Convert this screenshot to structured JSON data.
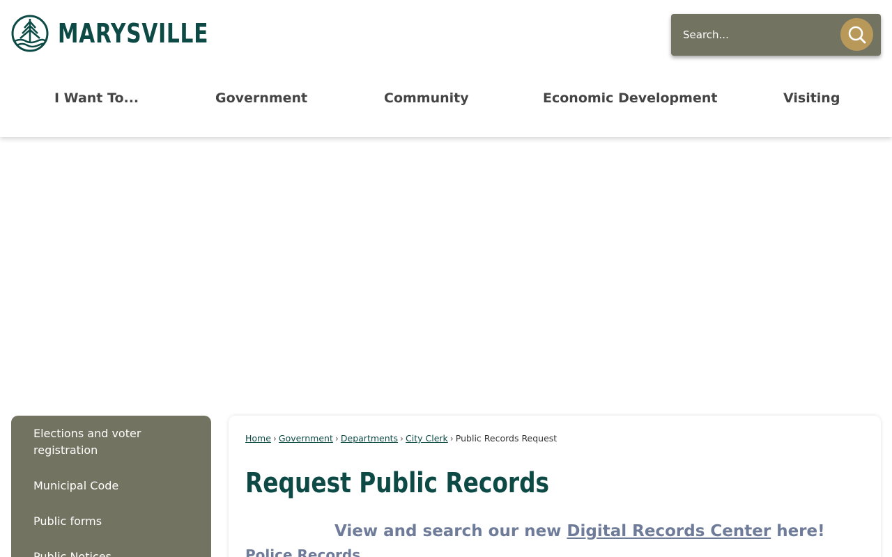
{
  "site": {
    "name": "MARYSVILLE",
    "brand_color": "#0d4a45",
    "accent_color": "#b9995a",
    "panel_color": "#727360",
    "logo_icon": "evergreen-tree-wave-icon"
  },
  "search": {
    "placeholder": "Search...",
    "button_icon": "search-icon"
  },
  "nav": {
    "items": [
      "I Want To...",
      "Government",
      "Community",
      "Economic Development",
      "Visiting"
    ]
  },
  "sidebar": {
    "items": [
      "Elections and voter registration",
      "Municipal Code",
      "Public forms",
      "Public Notices"
    ]
  },
  "breadcrumb": {
    "items": [
      "Home",
      "Government",
      "Departments",
      "City Clerk"
    ],
    "current": "Public Records Request"
  },
  "main": {
    "title": "Request Public Records",
    "promo_prefix": "View and search our new ",
    "promo_link": "Digital Records Center",
    "promo_suffix": " here!",
    "police_link": "Police Records"
  }
}
